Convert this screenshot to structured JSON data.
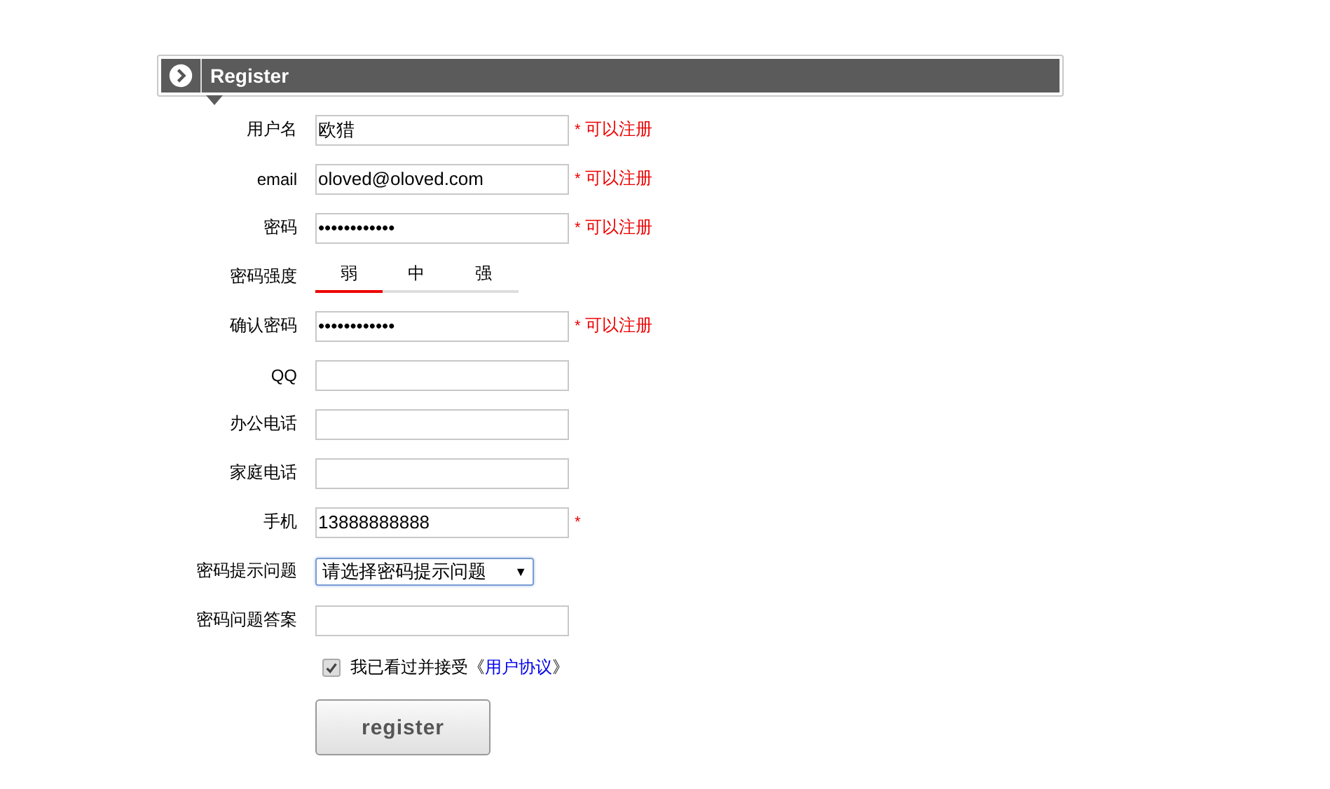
{
  "header": {
    "title": "Register"
  },
  "fields": [
    {
      "kind": "text",
      "label": "用户名",
      "value": "欧猎",
      "mark": "*",
      "hint": "可以注册"
    },
    {
      "kind": "text",
      "label": "email",
      "value": "oloved@oloved.com",
      "mark": "*",
      "hint": "可以注册"
    },
    {
      "kind": "text",
      "label": "密码",
      "value": "••••••••••••",
      "mark": "*",
      "hint": "可以注册"
    },
    {
      "kind": "strength",
      "label": "密码强度",
      "levels": [
        {
          "label": "弱",
          "selected": true
        },
        {
          "label": "中",
          "selected": false
        },
        {
          "label": "强",
          "selected": false
        }
      ]
    },
    {
      "kind": "text",
      "label": "确认密码",
      "value": "••••••••••••",
      "mark": "*",
      "hint": "可以注册"
    },
    {
      "kind": "text",
      "label": "QQ"
    },
    {
      "kind": "text",
      "label": "办公电话"
    },
    {
      "kind": "text",
      "label": "家庭电话"
    },
    {
      "kind": "text",
      "label": "手机",
      "value": "13888888888",
      "mark": "*"
    },
    {
      "kind": "select",
      "label": "密码提示问题",
      "value": "请选择密码提示问题",
      "arrow": "▼"
    },
    {
      "kind": "text",
      "label": "密码问题答案"
    }
  ],
  "agreement": {
    "checked": true,
    "text": "我已看过并接受《",
    "link": "用户协议",
    "after": "》"
  },
  "submit": "register"
}
